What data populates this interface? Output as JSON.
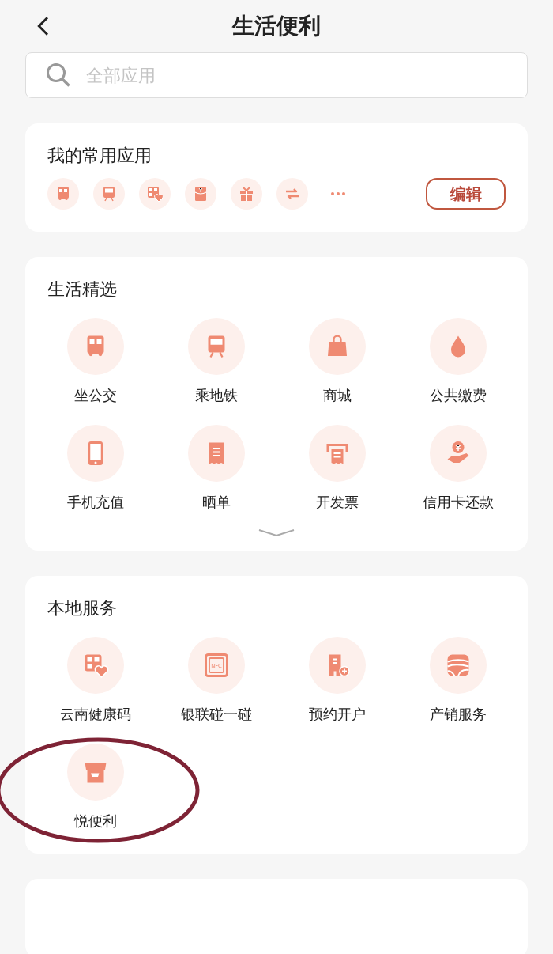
{
  "header": {
    "title": "生活便利"
  },
  "search": {
    "placeholder": "全部应用"
  },
  "favorites": {
    "title": "我的常用应用",
    "icons": [
      {
        "kind": "bus"
      },
      {
        "kind": "metro"
      },
      {
        "kind": "health"
      },
      {
        "kind": "envelope"
      },
      {
        "kind": "gift"
      },
      {
        "kind": "transfer"
      },
      {
        "kind": "more"
      }
    ],
    "edit": "编辑"
  },
  "sections": [
    {
      "title": "生活精选",
      "items": [
        {
          "kind": "bus",
          "label": "坐公交"
        },
        {
          "kind": "metro",
          "label": "乘地铁"
        },
        {
          "kind": "bag",
          "label": "商城"
        },
        {
          "kind": "drop",
          "label": "公共缴费"
        },
        {
          "kind": "phone",
          "label": "手机充值"
        },
        {
          "kind": "receipt",
          "label": "晒单"
        },
        {
          "kind": "invoice",
          "label": "开发票"
        },
        {
          "kind": "hand",
          "label": "信用卡还款"
        }
      ],
      "expandable": true
    },
    {
      "title": "本地服务",
      "items": [
        {
          "kind": "health",
          "label": "云南健康码"
        },
        {
          "kind": "nfc",
          "label": "银联碰一碰",
          "icon_text": "NFC"
        },
        {
          "kind": "building",
          "label": "预约开户"
        },
        {
          "kind": "fields",
          "label": "产销服务"
        },
        {
          "kind": "store",
          "label": "悦便利",
          "circled": true
        }
      ],
      "expandable": false
    }
  ]
}
